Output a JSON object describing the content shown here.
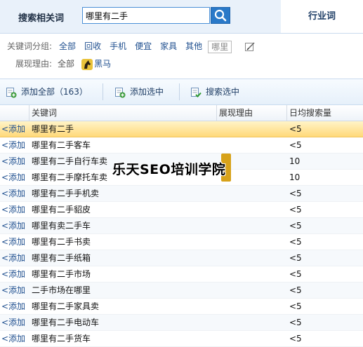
{
  "header": {
    "search_tab_label": "搜索相关词",
    "search_value": "哪里有二手",
    "right_tab_label": "行业词"
  },
  "filters": {
    "group_label": "关键词分组:",
    "groups": [
      "全部",
      "回收",
      "手机",
      "便宜",
      "家具",
      "其他"
    ],
    "group_box": "哪里",
    "reason_label": "展现理由:",
    "reason_all": "全部",
    "reason_horse": "黑马"
  },
  "toolbar": {
    "add_all": "添加全部（163）",
    "add_selected": "添加选中",
    "search_selected": "搜索选中"
  },
  "table": {
    "columns": [
      "关键词",
      "展现理由",
      "日均搜索量"
    ],
    "add_label": "<添加",
    "rows": [
      {
        "kw": "哪里有二手",
        "vol": "<5"
      },
      {
        "kw": "哪里有二手客车",
        "vol": "<5"
      },
      {
        "kw": "哪里有二手自行车卖",
        "vol": "10"
      },
      {
        "kw": "哪里有二手摩托车卖",
        "vol": "10"
      },
      {
        "kw": "哪里有二手手机卖",
        "vol": "<5"
      },
      {
        "kw": "哪里有二手貂皮",
        "vol": "<5"
      },
      {
        "kw": "哪里有卖二手车",
        "vol": "<5"
      },
      {
        "kw": "哪里有二手书卖",
        "vol": "<5"
      },
      {
        "kw": "哪里有二手纸箱",
        "vol": "<5"
      },
      {
        "kw": "哪里有二手市场",
        "vol": "<5"
      },
      {
        "kw": "二手市场在哪里",
        "vol": "<5"
      },
      {
        "kw": "哪里有二手家具卖",
        "vol": "<5"
      },
      {
        "kw": "哪里有二手电动车",
        "vol": "<5"
      },
      {
        "kw": "哪里有二手货车",
        "vol": "<5"
      }
    ]
  },
  "watermark": "乐天SEO培训学院",
  "colors": {
    "accent": "#2a79c8",
    "link": "#1f4f8f",
    "selected_row": "#ffd97a",
    "header_bg": "#e9f1fa"
  }
}
